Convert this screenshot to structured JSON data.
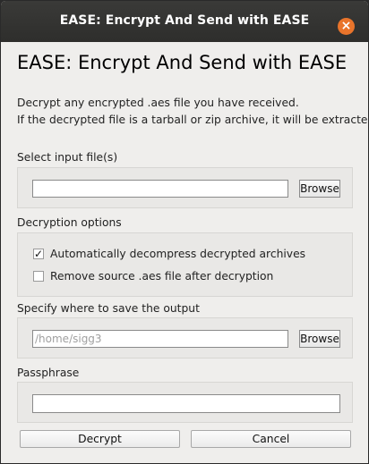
{
  "window": {
    "title": "EASE: Encrypt And Send with EASE",
    "close_glyph": "×",
    "close_color": "#e9742b"
  },
  "header": {
    "title": "EASE: Encrypt And Send with EASE",
    "description_line1": "Decrypt any encrypted .aes file you have received.",
    "description_line2": "If the decrypted file is a tarball or zip archive, it will be extracted."
  },
  "input_section": {
    "label": "Select input file(s)",
    "value": "",
    "browse_label": "Browse"
  },
  "options_section": {
    "label": "Decryption options",
    "options": [
      {
        "label": "Automatically decompress decrypted archives",
        "checked": true
      },
      {
        "label": "Remove source .aes file after decryption",
        "checked": false
      }
    ]
  },
  "output_section": {
    "label": "Specify where to save the output",
    "placeholder": "/home/sigg3",
    "browse_label": "Browse"
  },
  "passphrase_section": {
    "label": "Passphrase",
    "value": ""
  },
  "actions": {
    "decrypt_label": "Decrypt",
    "cancel_label": "Cancel"
  }
}
